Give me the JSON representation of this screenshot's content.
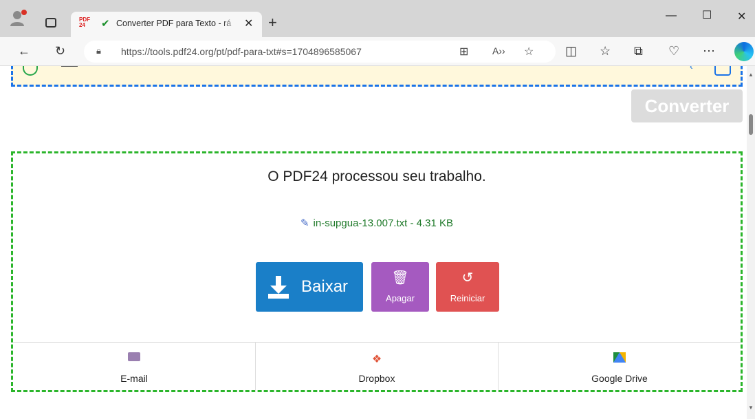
{
  "browser": {
    "tab": {
      "favicon_text": "PDF 24",
      "status_icon": "check-icon",
      "title": "Converter PDF para Texto - rá"
    },
    "url": "https://tools.pdf24.org/pt/pdf-para-txt#s=1704896585067"
  },
  "page": {
    "convert_button": "Converter",
    "result": {
      "title": "O PDF24 processou seu trabalho.",
      "file_label": "in-supgua-13.007.txt - 4.31 KB",
      "buttons": {
        "download": "Baixar",
        "delete": "Apagar",
        "reset": "Reiniciar"
      },
      "share": {
        "email": "E-mail",
        "dropbox": "Dropbox",
        "google_drive": "Google Drive"
      }
    }
  },
  "colors": {
    "download": "#1a7fc8",
    "delete": "#a55ac0",
    "reset": "#e05252",
    "result_border": "#2bb52b",
    "file_link": "#1f7a2a"
  }
}
